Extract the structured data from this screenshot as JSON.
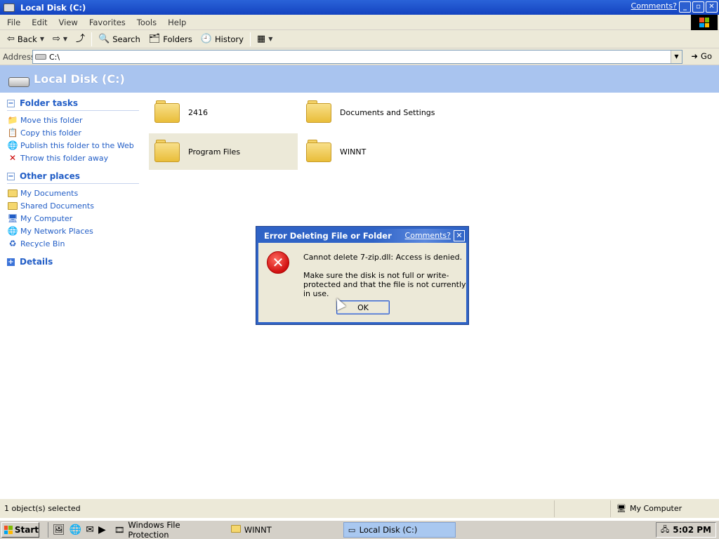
{
  "window": {
    "title": "Local Disk (C:)",
    "comments_link": "Comments?",
    "buttons": {
      "minimize": "_",
      "maximize": "▫",
      "close": "✕"
    }
  },
  "menu": [
    "File",
    "Edit",
    "View",
    "Favorites",
    "Tools",
    "Help"
  ],
  "toolbar": {
    "back_label": "Back",
    "search_label": "Search",
    "folders_label": "Folders",
    "history_label": "History"
  },
  "address": {
    "label": "Address",
    "value": "C:\\",
    "go_label": "Go"
  },
  "header": {
    "title": "Local Disk (C:)"
  },
  "left_pane": {
    "folder_tasks": {
      "title": "Folder tasks",
      "items": [
        "Move this folder",
        "Copy this folder",
        "Publish this folder to the Web",
        "Throw this folder away"
      ]
    },
    "other_places": {
      "title": "Other places",
      "items": [
        "My Documents",
        "Shared Documents",
        "My Computer",
        "My Network Places",
        "Recycle Bin"
      ]
    },
    "details": {
      "title": "Details"
    }
  },
  "folders": [
    {
      "name": "2416",
      "selected": false
    },
    {
      "name": "Documents and Settings",
      "selected": false
    },
    {
      "name": "Program Files",
      "selected": true
    },
    {
      "name": "WINNT",
      "selected": false
    }
  ],
  "dialog": {
    "title": "Error Deleting File or Folder",
    "comments_link": "Comments?",
    "message": "Cannot delete 7-zip.dll: Access is denied.",
    "detail": "Make sure the disk is not full or write-protected and that the file is not currently in use.",
    "ok_label": "OK"
  },
  "statusbar": {
    "selection": "1 object(s) selected",
    "zone": "My Computer"
  },
  "taskbar": {
    "start_label": "Start",
    "tasks": [
      {
        "label": "Windows File Protection",
        "active": false
      },
      {
        "label": "WINNT",
        "active": false
      },
      {
        "label": "Local Disk (C:)",
        "active": true
      }
    ],
    "clock": "5:02 PM"
  }
}
